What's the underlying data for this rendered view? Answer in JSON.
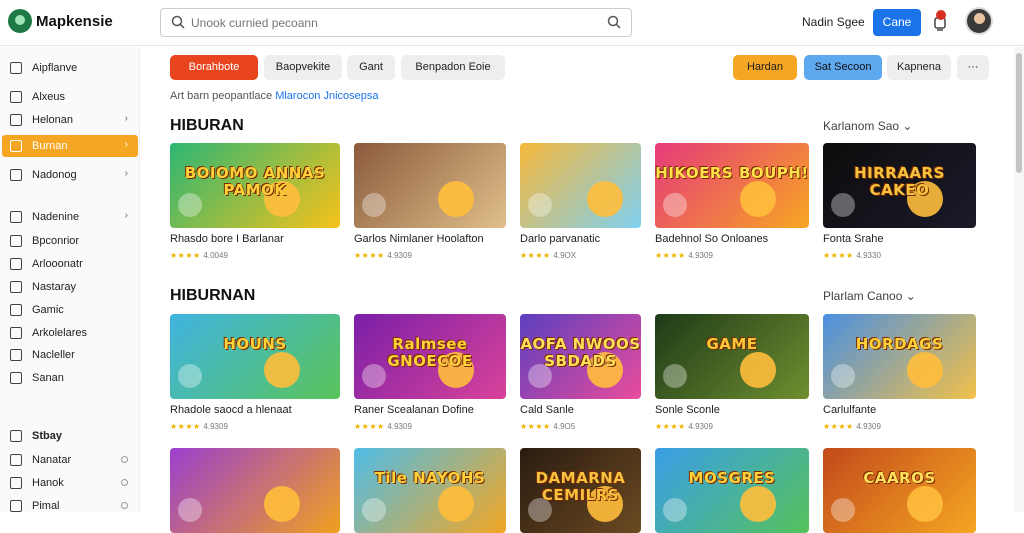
{
  "app": {
    "brand": "Mapkensie"
  },
  "search": {
    "placeholder": "Unook curnied pecoann"
  },
  "header": {
    "user_link": "Nadin Sgee",
    "button_label": "Cane"
  },
  "sidebar": {
    "items": [
      {
        "label": "Aipflanve",
        "icon": "app-icon",
        "chevron": false,
        "active": false,
        "bold": false
      },
      {
        "label": "Alxeus",
        "icon": "image-icon",
        "chevron": false,
        "active": false,
        "bold": false
      },
      {
        "label": "Helonan",
        "icon": "list-icon",
        "chevron": true,
        "active": false,
        "bold": false
      },
      {
        "label": "Burnan",
        "icon": "folder-icon",
        "chevron": true,
        "active": true,
        "bold": false
      },
      {
        "label": "Nadonog",
        "icon": "calendar-icon",
        "chevron": true,
        "active": false,
        "bold": false
      },
      {
        "label": "Nadenine",
        "icon": "pencil-icon",
        "chevron": true,
        "active": false,
        "bold": false
      },
      {
        "label": "Bpconrior",
        "icon": "book-icon",
        "chevron": false,
        "active": false,
        "bold": false
      },
      {
        "label": "Arlooonatr",
        "icon": "edit-icon",
        "chevron": false,
        "active": false,
        "bold": false
      },
      {
        "label": "Nastaray",
        "icon": "mail-icon",
        "chevron": false,
        "active": false,
        "bold": false
      },
      {
        "label": "Gamic",
        "icon": "gamepad-icon",
        "chevron": false,
        "active": false,
        "bold": false
      },
      {
        "label": "Arkolelares",
        "icon": "document-icon",
        "chevron": false,
        "active": false,
        "bold": false
      },
      {
        "label": "Nacleller",
        "icon": "bookmark-icon",
        "chevron": false,
        "active": false,
        "bold": false
      },
      {
        "label": "Sanan",
        "icon": "circle-icon",
        "chevron": false,
        "active": false,
        "bold": false
      },
      {
        "label": "Stbay",
        "icon": "tag-icon",
        "chevron": false,
        "active": false,
        "bold": true
      },
      {
        "label": "Nanatar",
        "icon": "user-icon",
        "chevron": false,
        "active": false,
        "bold": false,
        "radio": true
      },
      {
        "label": "Hanok",
        "icon": "settings-icon",
        "chevron": false,
        "active": false,
        "bold": false,
        "radio": true
      },
      {
        "label": "Pimal",
        "icon": "grid-icon",
        "chevron": false,
        "active": false,
        "bold": false,
        "radio": true
      }
    ]
  },
  "filters": [
    {
      "label": "Borahbote",
      "style": "red"
    },
    {
      "label": "Baopvekite",
      "style": "gray"
    },
    {
      "label": "Gant",
      "style": "gray"
    },
    {
      "label": "Benpadon   Eoie",
      "style": "gray"
    },
    {
      "label": "Hardan",
      "style": "orange"
    },
    {
      "label": "Sat Secoon",
      "style": "blue"
    },
    {
      "label": "Kapnena",
      "style": "gray"
    },
    {
      "label": "···",
      "style": "gray"
    }
  ],
  "breadcrumb": {
    "text": "Art barn peopantlace ",
    "link": "Mlarocon Jnicosepsa"
  },
  "sections": [
    {
      "title": "HIBURAN",
      "more": "Karlanom Sao",
      "cards": [
        {
          "title": "Rhasdo bore I Barlanar",
          "rating": "4.0049",
          "thumb_text": "BOIOMO ANNAS PAMOK",
          "bg": [
            "#2bb673",
            "#f7c21a"
          ],
          "text_color": "#ffd23a"
        },
        {
          "title": "Garlos Nimlaner Hoolafton",
          "rating": "4.9309",
          "thumb_text": "",
          "bg": [
            "#8a5a3c",
            "#e0c08a"
          ],
          "text_color": "#ffffff"
        },
        {
          "title": "Darlo parvanatic",
          "rating": "4.9OX",
          "thumb_text": "",
          "bg": [
            "#f5b73b",
            "#7fd0f0"
          ],
          "text_color": "#ffffff"
        },
        {
          "title": "Badehnol So Onloanes",
          "rating": "4.9309",
          "thumb_text": "HIKOERS BOUPH!",
          "bg": [
            "#e53a7a",
            "#f7a623"
          ],
          "text_color": "#ffe14a"
        },
        {
          "title": "Fonta Srahe",
          "rating": "4.9330",
          "thumb_text": "HIRRAARS CAKEO",
          "bg": [
            "#0d0d0d",
            "#1a1a2a"
          ],
          "text_color": "#f5c340"
        }
      ]
    },
    {
      "title": "HIBURNAN",
      "more": "Plarlam Canoo",
      "cards": [
        {
          "title": "Rhadole saocd a hlenaat",
          "rating": "4.9309",
          "thumb_text": "HOUNS",
          "bg": [
            "#3fb4e0",
            "#5ac45a"
          ],
          "text_color": "#ffd23a"
        },
        {
          "title": "Raner Scealanan Dofine",
          "rating": "4.9309",
          "thumb_text": "Ralmsee GNOECOE",
          "bg": [
            "#7a1fa8",
            "#d9439a"
          ],
          "text_color": "#ffd23a"
        },
        {
          "title": "Cald Sanle",
          "rating": "4.9O5",
          "thumb_text": "AOFA NWOOS SBDADS",
          "bg": [
            "#5b3fbf",
            "#e94c9c"
          ],
          "text_color": "#ffe05a"
        },
        {
          "title": "Sonle Sconle",
          "rating": "4.9309",
          "thumb_text": "GAME",
          "bg": [
            "#1e3a18",
            "#6f8f2f"
          ],
          "text_color": "#ffc83a"
        },
        {
          "title": "Carlulfante",
          "rating": "4.9309",
          "thumb_text": "HORDAGS",
          "bg": [
            "#4a8fe0",
            "#f2c14a"
          ],
          "text_color": "#ffd23a"
        }
      ]
    },
    {
      "cards": [
        {
          "thumb_text": "",
          "bg": [
            "#9b3fcf",
            "#f0a020"
          ],
          "text_color": "#ffd23a"
        },
        {
          "thumb_text": "Tile NAYOHS",
          "bg": [
            "#4fbde8",
            "#f2a623"
          ],
          "text_color": "#ffd23a"
        },
        {
          "thumb_text": "DAMARNA CEMILRS",
          "bg": [
            "#2a1b10",
            "#6b4a22"
          ],
          "text_color": "#f5c340"
        },
        {
          "thumb_text": "MOSGRES",
          "bg": [
            "#3a9ee8",
            "#56c25a"
          ],
          "text_color": "#ffd23a"
        },
        {
          "thumb_text": "CAAROS",
          "bg": [
            "#c24a1a",
            "#f5a623"
          ],
          "text_color": "#ffe05a"
        }
      ]
    }
  ],
  "colors": {
    "accent": "#f5a623",
    "primary": "#1a73e8",
    "danger": "#e8451f"
  }
}
